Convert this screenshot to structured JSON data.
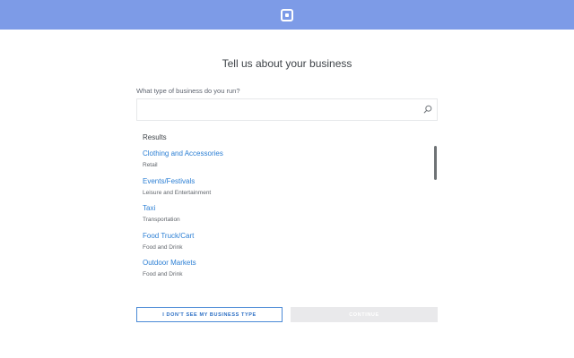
{
  "header": {
    "logo_icon": "square-logo-icon",
    "brand_color": "#7d9be7"
  },
  "page": {
    "title": "Tell us about your business"
  },
  "search": {
    "label": "What type of business do you run?",
    "value": "",
    "placeholder": "",
    "icon": "search-icon"
  },
  "results": {
    "header": "Results",
    "items": [
      {
        "name": "Clothing and Accessories",
        "category": "Retail"
      },
      {
        "name": "Events/Festivals",
        "category": "Leisure and Entertainment"
      },
      {
        "name": "Taxi",
        "category": "Transportation"
      },
      {
        "name": "Food Truck/Cart",
        "category": "Food and Drink"
      },
      {
        "name": "Outdoor Markets",
        "category": "Food and Drink"
      }
    ]
  },
  "actions": {
    "not_listed_label": "I don't see my business type",
    "continue_label": "Continue"
  }
}
